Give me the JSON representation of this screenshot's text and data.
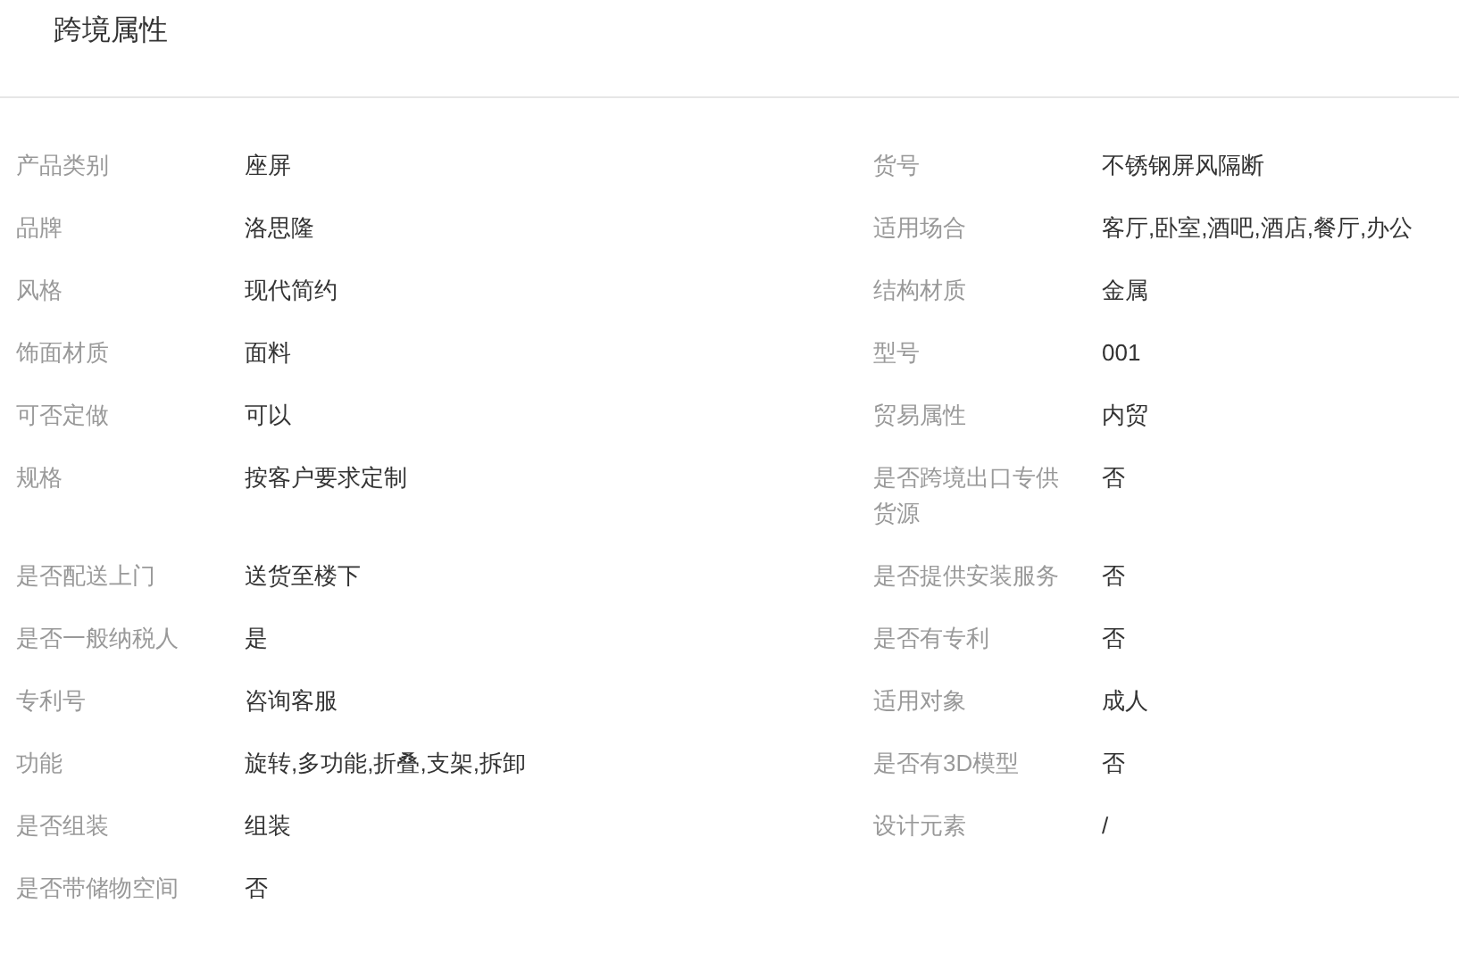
{
  "title": "跨境属性",
  "attributes": [
    {
      "label": "产品类别",
      "value": "座屏"
    },
    {
      "label": "货号",
      "value": "不锈钢屏风隔断"
    },
    {
      "label": "品牌",
      "value": "洛思隆"
    },
    {
      "label": "适用场合",
      "value": "客厅,卧室,酒吧,酒店,餐厅,办公"
    },
    {
      "label": "风格",
      "value": "现代简约"
    },
    {
      "label": "结构材质",
      "value": "金属"
    },
    {
      "label": "饰面材质",
      "value": "面料"
    },
    {
      "label": "型号",
      "value": "001"
    },
    {
      "label": "可否定做",
      "value": "可以"
    },
    {
      "label": "贸易属性",
      "value": "内贸"
    },
    {
      "label": "规格",
      "value": "按客户要求定制"
    },
    {
      "label": "是否跨境出口专供货源",
      "value": "否"
    },
    {
      "label": "是否配送上门",
      "value": "送货至楼下"
    },
    {
      "label": "是否提供安装服务",
      "value": "否"
    },
    {
      "label": "是否一般纳税人",
      "value": "是"
    },
    {
      "label": "是否有专利",
      "value": "否"
    },
    {
      "label": "专利号",
      "value": "咨询客服"
    },
    {
      "label": "适用对象",
      "value": "成人"
    },
    {
      "label": "功能",
      "value": "旋转,多功能,折叠,支架,拆卸"
    },
    {
      "label": "是否有3D模型",
      "value": "否"
    },
    {
      "label": "是否组装",
      "value": "组装"
    },
    {
      "label": "设计元素",
      "value": "/"
    },
    {
      "label": "是否带储物空间",
      "value": "否"
    }
  ]
}
